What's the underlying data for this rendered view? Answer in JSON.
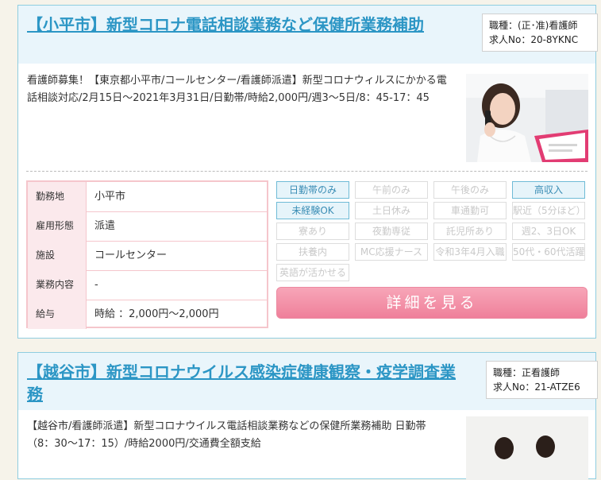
{
  "jobs": [
    {
      "title": "【小平市】新型コロナ電話相談業務など保健所業務補助",
      "occupation": "職種：(正･准)看護師",
      "job_no": "求人No：20-8YKNC",
      "description": "看護師募集！【東京都小平市/コールセンター/看護師派遣】新型コロナウィルスにかかる電話相談対応/2月15日～2021年3月31日/日勤帯/時給2,000円/週3～5日/8：45-17：45",
      "specs": [
        {
          "label": "勤務地",
          "value": "小平市"
        },
        {
          "label": "雇用形態",
          "value": "派遣"
        },
        {
          "label": "施設",
          "value": "コールセンター"
        },
        {
          "label": "業務内容",
          "value": "-"
        },
        {
          "label": "給与",
          "value": "時給 ：2,000円～2,000円"
        }
      ],
      "tags": [
        {
          "label": "日勤帯のみ",
          "active": true
        },
        {
          "label": "午前のみ",
          "active": false
        },
        {
          "label": "午後のみ",
          "active": false
        },
        {
          "label": "高収入",
          "active": true
        },
        {
          "label": "未経験OK",
          "active": true
        },
        {
          "label": "土日休み",
          "active": false
        },
        {
          "label": "車通勤可",
          "active": false
        },
        {
          "label": "駅近（5分ほど）",
          "active": false
        },
        {
          "label": "寮あり",
          "active": false
        },
        {
          "label": "夜勤専従",
          "active": false
        },
        {
          "label": "託児所あり",
          "active": false
        },
        {
          "label": "週2、3日OK",
          "active": false
        },
        {
          "label": "扶養内",
          "active": false
        },
        {
          "label": "MC応援ナース",
          "active": false
        },
        {
          "label": "令和3年4月入職",
          "active": false
        },
        {
          "label": "50代・60代活躍",
          "active": false
        },
        {
          "label": "英語が活かせる",
          "active": false
        }
      ],
      "detail_label": "詳細を見る"
    },
    {
      "title": "【越谷市】新型コロナウイルス感染症健康観察・疫学調査業務",
      "occupation": "職種：正看護師",
      "job_no": "求人No：21-ATZE6",
      "description": "【越谷市/看護師派遣】新型コロナウイルス電話相談業務などの保健所業務補助 日勤帯（8：30～17：15）/時給2000円/交通費全額支給"
    }
  ],
  "colors": {
    "title": "#2c96c5",
    "border": "#8fcde0",
    "header_bg": "#e9f5fb",
    "tag_active_bg": "#e6f4fa",
    "spec_border": "#f5c6cc",
    "button": "#ef7f9a"
  }
}
